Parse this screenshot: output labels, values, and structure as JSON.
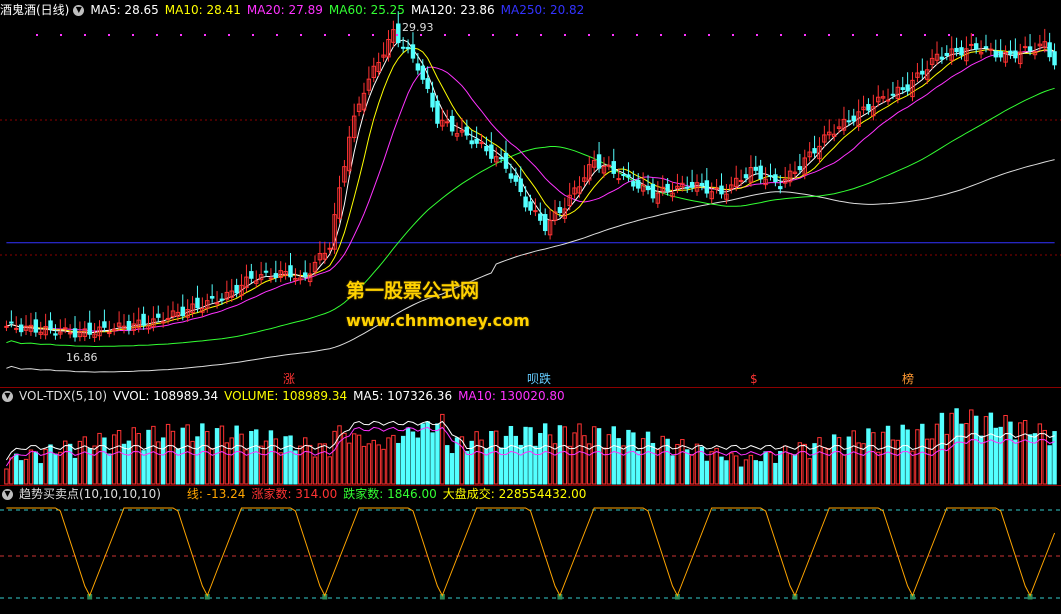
{
  "main": {
    "name": "酒鬼酒(日线)",
    "ma_labels": [
      {
        "text": "MA5: 28.65",
        "color": "#ffffff"
      },
      {
        "text": "MA10: 28.41",
        "color": "#ffff00"
      },
      {
        "text": "MA20: 27.89",
        "color": "#ff33ff"
      },
      {
        "text": "MA60: 25.25",
        "color": "#33ff33"
      },
      {
        "text": "MA120: 23.86",
        "color": "#ffffff"
      },
      {
        "text": "MA250: 20.82",
        "color": "#3333ff"
      }
    ],
    "high_label": "29.93",
    "low_label": "16.86",
    "markers": [
      {
        "text": "涨",
        "color": "#ff3333"
      },
      {
        "text": "呗跌",
        "color": "#66ccff"
      },
      {
        "text": "$",
        "color": "#ff3333"
      },
      {
        "text": "榜",
        "color": "#ff9933"
      }
    ],
    "watermark_title": "第一股票公式网",
    "watermark_url": "www.chnmoney.com"
  },
  "volume": {
    "name": "VOL-TDX(5,10)",
    "labels": [
      {
        "text": "VVOL: 108989.34",
        "color": "#ffffff"
      },
      {
        "text": "VOLUME: 108989.34",
        "color": "#ffff00"
      },
      {
        "text": "MA5: 107326.36",
        "color": "#ffffff"
      },
      {
        "text": "MA10: 130020.80",
        "color": "#ff33ff"
      }
    ]
  },
  "indicator": {
    "name": "趋势买卖点(10,10,10,10)",
    "labels": [
      {
        "text": "线: -13.24",
        "color": "#ffa500"
      },
      {
        "text": "涨家数: 314.00",
        "color": "#ff3333"
      },
      {
        "text": "跌家数: 1846.00",
        "color": "#33ff33"
      },
      {
        "text": "大盘成交: 228554432.00",
        "color": "#ffff00"
      }
    ]
  },
  "colors": {
    "up": "#ff3333",
    "down": "#54ffff",
    "grid": "#8b0000",
    "bg": "#000000"
  }
}
